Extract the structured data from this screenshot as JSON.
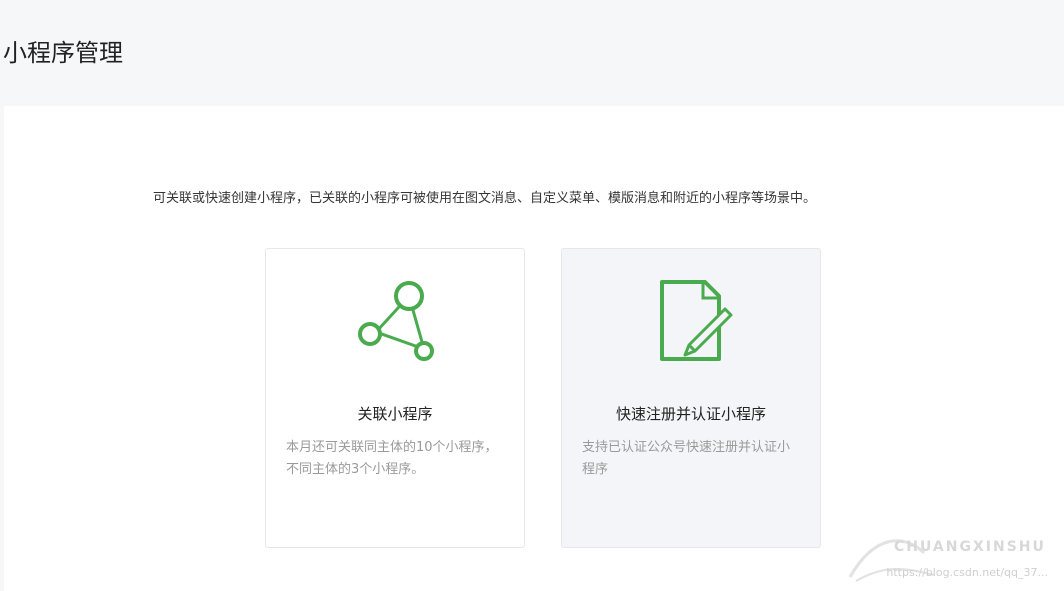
{
  "header": {
    "title": "小程序管理"
  },
  "main": {
    "intro": "可关联或快速创建小程序，已关联的小程序可被使用在图文消息、自定义菜单、模版消息和附近的小程序等场景中。",
    "cards": [
      {
        "title": "关联小程序",
        "description": "本月还可关联同主体的10个小程序，不同主体的3个小程序。",
        "icon": "link-nodes-icon"
      },
      {
        "title": "快速注册并认证小程序",
        "description": "支持已认证公众号快速注册并认证小程序",
        "icon": "document-pen-icon"
      }
    ]
  },
  "watermark": {
    "brand": "CHUANGXINSHU",
    "url": "https://blog.csdn.net/qq_37..."
  },
  "colors": {
    "accent": "#4aab4e",
    "header_bg": "#f6f7f9",
    "card_border": "#e4e8eb"
  }
}
